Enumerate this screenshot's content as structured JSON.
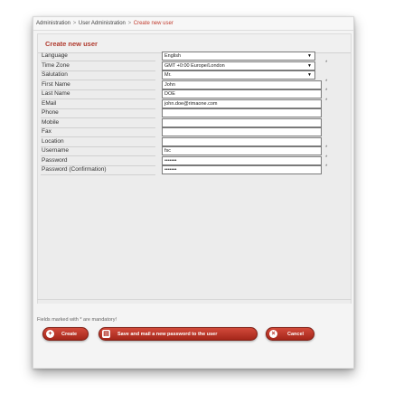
{
  "breadcrumb": {
    "items": [
      "Administration",
      "User Administration",
      "Create new user"
    ],
    "separator": ">"
  },
  "page": {
    "title": "Create new user"
  },
  "form": {
    "language": {
      "label": "Language",
      "value": "English"
    },
    "time_zone": {
      "label": "Time Zone",
      "value": "GMT +0:00 Europe/London",
      "required": "*"
    },
    "salutation": {
      "label": "Salutation",
      "value": "Mr."
    },
    "first_name": {
      "label": "First Name",
      "value": "John",
      "required": "*"
    },
    "last_name": {
      "label": "Last Name",
      "value": "DOE",
      "required": "*"
    },
    "email": {
      "label": "EMail",
      "value": "john.doe@rimaone.com",
      "required": "*"
    },
    "phone": {
      "label": "Phone",
      "value": ""
    },
    "mobile": {
      "label": "Mobile",
      "value": ""
    },
    "fax": {
      "label": "Fax",
      "value": ""
    },
    "location": {
      "label": "Location",
      "value": ""
    },
    "username": {
      "label": "Username",
      "value": "fsc",
      "required": "*"
    },
    "password": {
      "label": "Password",
      "value": "•••••••",
      "required": "*"
    },
    "password_confirmation": {
      "label": "Password (Confirmation)",
      "value": "•••••••",
      "required": "*"
    },
    "dropdown_arrow": "▼"
  },
  "footer": {
    "mandatory_note": "Fields marked with * are mandatory!"
  },
  "buttons": {
    "create": {
      "label": "Create",
      "icon": "plus-circle-icon"
    },
    "save_mail": {
      "label": "Save and mail a new password to the user",
      "icon": "save-disk-icon"
    },
    "cancel": {
      "label": "Cancel",
      "icon": "close-icon"
    }
  },
  "colors": {
    "accent": "#c0392b",
    "button": "#b83224"
  }
}
